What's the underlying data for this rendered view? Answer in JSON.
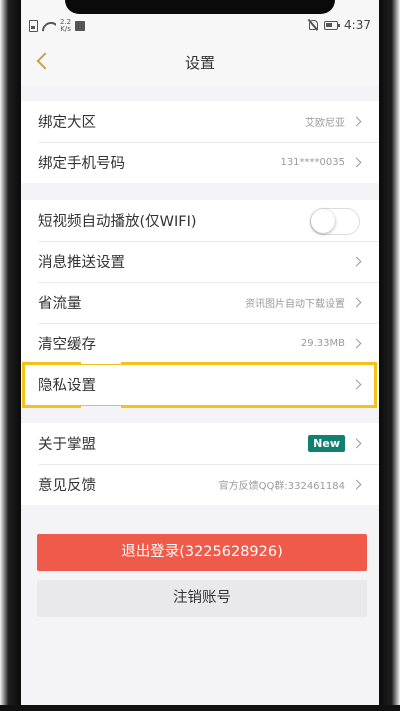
{
  "status_bar": {
    "network_speed_value": "2.2",
    "network_speed_unit": "K/s",
    "time": "4:37",
    "icons": [
      "sim-card-icon",
      "wifi-icon",
      "photo-icon",
      "mute-icon",
      "battery-icon"
    ]
  },
  "header": {
    "title": "设置",
    "back_icon": "chevron-left-icon"
  },
  "groups": {
    "account": [
      {
        "label": "绑定大区",
        "value": "艾欧尼亚"
      },
      {
        "label": "绑定手机号码",
        "value": "131****0035"
      }
    ],
    "preferences": [
      {
        "label": "短视频自动播放(仅WIFI)",
        "toggle": false
      },
      {
        "label": "消息推送设置",
        "value": ""
      },
      {
        "label": "省流量",
        "value": "资讯图片自动下载设置"
      },
      {
        "label": "清空缓存",
        "value": "29.33MB"
      },
      {
        "label": "隐私设置",
        "value": "",
        "highlighted": true
      }
    ],
    "about": [
      {
        "label": "关于掌盟",
        "badge": "New"
      },
      {
        "label": "意见反馈",
        "value": "官方反馈QQ群:332461184"
      }
    ]
  },
  "buttons": {
    "logout_label": "退出登录(3225628926)",
    "deactivate_label": "注销账号"
  },
  "colors": {
    "accent_gold": "#c9a14a",
    "logout_red": "#f05a4a",
    "new_badge_green": "#13806f",
    "highlight_yellow": "#f5c21b"
  }
}
